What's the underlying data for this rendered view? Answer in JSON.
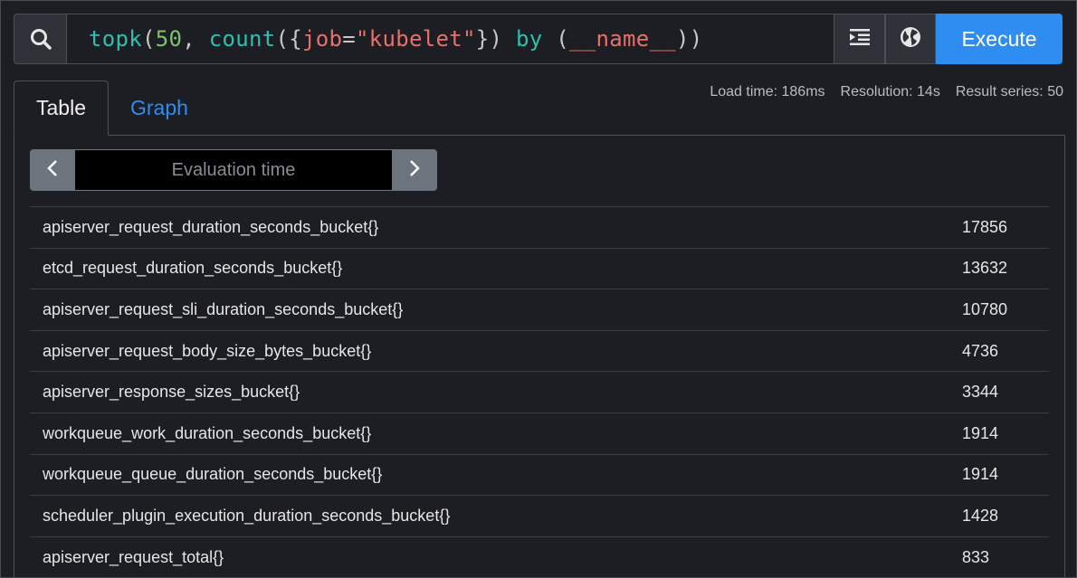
{
  "query": {
    "tokens": [
      {
        "t": "topk",
        "c": "fn"
      },
      {
        "t": "(",
        "c": "punc"
      },
      {
        "t": "50",
        "c": "num"
      },
      {
        "t": ", ",
        "c": "punc"
      },
      {
        "t": "count",
        "c": "fn"
      },
      {
        "t": "({",
        "c": "punc"
      },
      {
        "t": "job",
        "c": "label"
      },
      {
        "t": "=",
        "c": "punc"
      },
      {
        "t": "\"kubelet\"",
        "c": "str"
      },
      {
        "t": "})",
        "c": "punc"
      },
      {
        "t": " by ",
        "c": "kw"
      },
      {
        "t": "(",
        "c": "punc"
      },
      {
        "t": "__name__",
        "c": "id"
      },
      {
        "t": "))",
        "c": "punc"
      }
    ]
  },
  "toolbar": {
    "execute_label": "Execute",
    "search_icon": "search-icon",
    "format_icon": "indent-icon",
    "explore_icon": "globe-icon"
  },
  "tabs": {
    "table_label": "Table",
    "graph_label": "Graph"
  },
  "stats": {
    "load_time": "Load time: 186ms",
    "resolution": "Resolution: 14s",
    "result_series": "Result series: 50"
  },
  "eval": {
    "placeholder": "Evaluation time"
  },
  "colors": {
    "accent": "#2f8cf0",
    "background": "#1c1e23"
  },
  "rows": [
    {
      "metric": "apiserver_request_duration_seconds_bucket{}",
      "value": "17856"
    },
    {
      "metric": "etcd_request_duration_seconds_bucket{}",
      "value": "13632"
    },
    {
      "metric": "apiserver_request_sli_duration_seconds_bucket{}",
      "value": "10780"
    },
    {
      "metric": "apiserver_request_body_size_bytes_bucket{}",
      "value": "4736"
    },
    {
      "metric": "apiserver_response_sizes_bucket{}",
      "value": "3344"
    },
    {
      "metric": "workqueue_work_duration_seconds_bucket{}",
      "value": "1914"
    },
    {
      "metric": "workqueue_queue_duration_seconds_bucket{}",
      "value": "1914"
    },
    {
      "metric": "scheduler_plugin_execution_duration_seconds_bucket{}",
      "value": "1428"
    },
    {
      "metric": "apiserver_request_total{}",
      "value": "833"
    }
  ]
}
